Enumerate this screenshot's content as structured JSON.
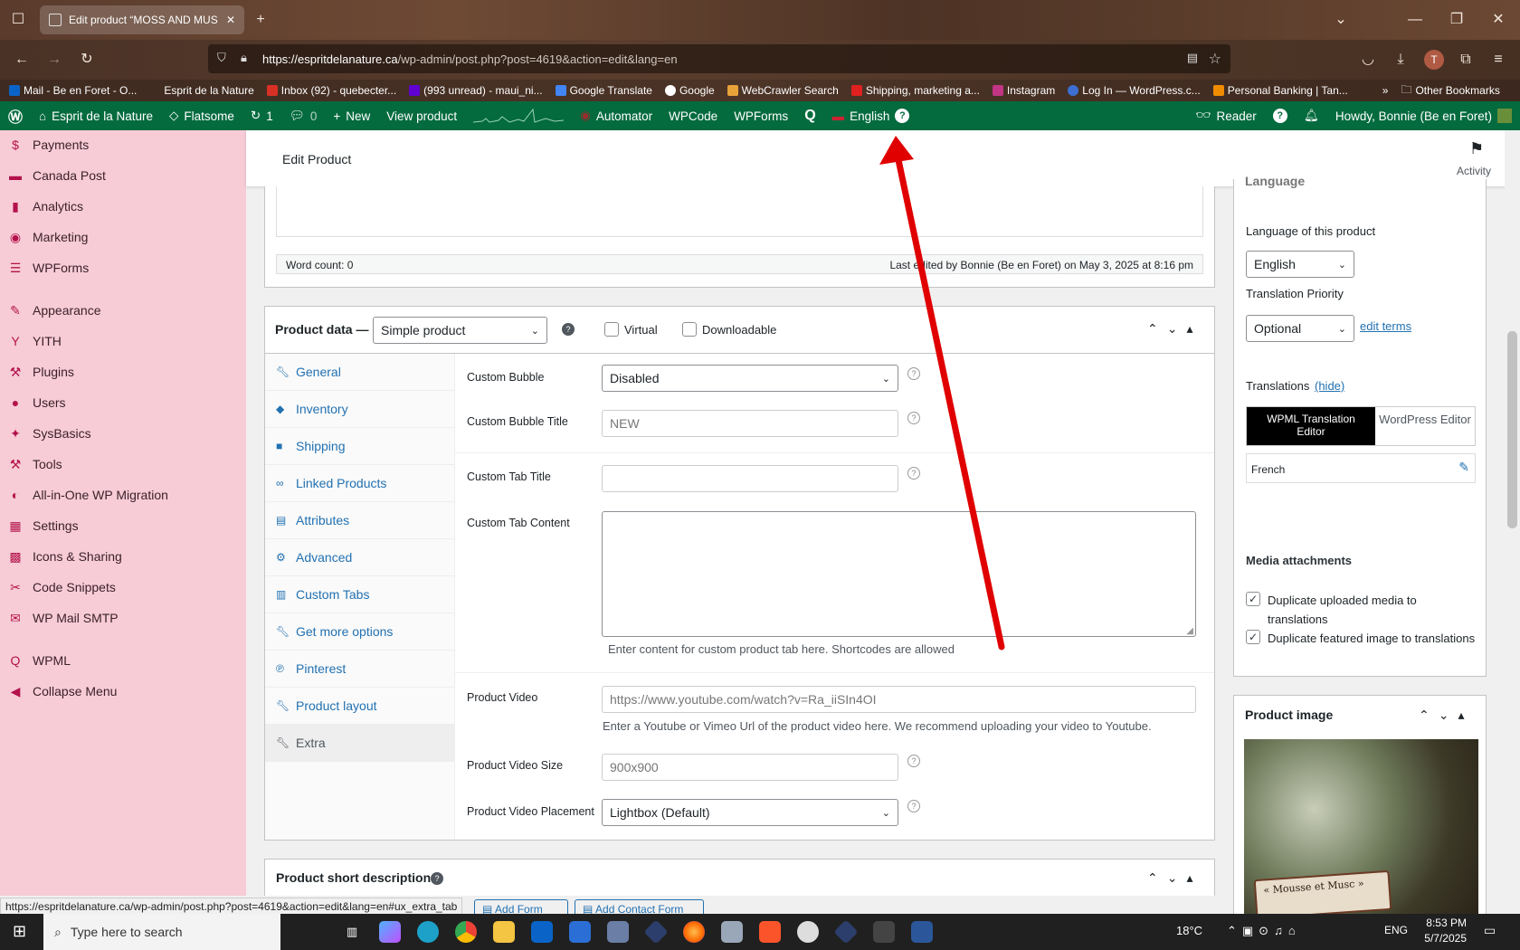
{
  "browser": {
    "tab_title": "Edit product “MOSS AND MUS",
    "url_domain": "https://espritdelanature.ca",
    "url_path": "/wp-admin/post.php?post=4619&action=edit&lang=en",
    "bookmarks": [
      "Mail - Be en Foret - O...",
      "Esprit de la Nature",
      "Inbox (92) - quebecter...",
      "(993 unread) - maui_ni...",
      "Google Translate",
      "Google",
      "WebCrawler Search",
      "Shipping, marketing a...",
      "Instagram",
      "Log In — WordPress.c...",
      "Personal Banking | Tan..."
    ],
    "other_bookmarks": "Other Bookmarks",
    "status_url": "https://espritdelanature.ca/wp-admin/post.php?post=4619&action=edit&lang=en#ux_extra_tab"
  },
  "adminbar": {
    "site": "Esprit de la Nature",
    "theme": "Flatsome",
    "updates": "1",
    "comments": "0",
    "new": "New",
    "view": "View product",
    "automator": "Automator",
    "wpcode": "WPCode",
    "wpforms": "WPForms",
    "language": "English",
    "reader": "Reader",
    "howdy": "Howdy, Bonnie (Be en Foret)"
  },
  "sidebar": {
    "items": [
      {
        "label": "Payments",
        "icon": "$"
      },
      {
        "label": "Canada Post",
        "icon": "▬"
      },
      {
        "label": "Analytics",
        "icon": "▮"
      },
      {
        "label": "Marketing",
        "icon": "◉"
      },
      {
        "label": "WPForms",
        "icon": "☰"
      },
      {
        "label": "Appearance",
        "icon": "✎"
      },
      {
        "label": "YITH",
        "icon": "Y"
      },
      {
        "label": "Plugins",
        "icon": "⚒"
      },
      {
        "label": "Users",
        "icon": "●"
      },
      {
        "label": "SysBasics",
        "icon": "✦"
      },
      {
        "label": "Tools",
        "icon": "⚒"
      },
      {
        "label": "All-in-One WP Migration",
        "icon": "◐"
      },
      {
        "label": "Settings",
        "icon": "▦"
      },
      {
        "label": "Icons & Sharing",
        "icon": "▩"
      },
      {
        "label": "Code Snippets",
        "icon": "✂"
      },
      {
        "label": "WP Mail SMTP",
        "icon": "✉"
      },
      {
        "label": "WPML",
        "icon": "Q"
      },
      {
        "label": "Collapse Menu",
        "icon": "◀"
      }
    ]
  },
  "header": {
    "title": "Edit Product",
    "activity": "Activity"
  },
  "editor": {
    "word_count": "Word count: 0",
    "last_edited": "Last edited by Bonnie (Be en Foret) on May 3, 2025 at 8:16 pm"
  },
  "product_data": {
    "label": "Product data —",
    "type": "Simple product",
    "virtual": "Virtual",
    "downloadable": "Downloadable",
    "tabs": [
      "General",
      "Inventory",
      "Shipping",
      "Linked Products",
      "Attributes",
      "Advanced",
      "Custom Tabs",
      "Get more options",
      "Pinterest",
      "Product layout",
      "Extra"
    ],
    "fields": {
      "bubble_label": "Custom Bubble",
      "bubble_value": "Disabled",
      "bubble_title_label": "Custom Bubble Title",
      "bubble_title_placeholder": "NEW",
      "tab_title_label": "Custom Tab Title",
      "tab_content_label": "Custom Tab Content",
      "tab_content_desc": "Enter content for custom product tab here. Shortcodes are allowed",
      "video_label": "Product Video",
      "video_placeholder": "https://www.youtube.com/watch?v=Ra_iiSIn4OI",
      "video_desc": "Enter a Youtube or Vimeo Url of the product video here. We recommend uploading your video to Youtube.",
      "video_size_label": "Product Video Size",
      "video_size_placeholder": "900x900",
      "video_placement_label": "Product Video Placement",
      "video_placement_value": "Lightbox (Default)"
    }
  },
  "short_desc": {
    "title": "Product short description",
    "add_form": "Add Form",
    "add_contact_form": "Add Contact Form"
  },
  "language_box": {
    "title": "Language",
    "lang_label": "Language of this product",
    "lang_value": "English",
    "priority_label": "Translation Priority",
    "priority_value": "Optional",
    "edit_terms": "edit terms",
    "translations_label": "Translations",
    "hide": "(hide)",
    "editor_wpml": "WPML Translation Editor",
    "editor_wp": "WordPress Editor",
    "french": "French",
    "media_title": "Media attachments",
    "dup_media": "Duplicate uploaded media to translations",
    "dup_featured": "Duplicate featured image to translations"
  },
  "product_image": {
    "title": "Product image",
    "label_text": "« Mousse et Musc »"
  },
  "taskbar": {
    "search": "Type here to search",
    "weather": "18°C",
    "lang": "ENG",
    "time": "8:53 PM",
    "date": "5/7/2025"
  },
  "colors": {
    "admin_green": "#046b3e",
    "sidebar_pink": "#f7ccd6",
    "link_blue": "#2271b1",
    "annotation_red": "#e00000"
  }
}
